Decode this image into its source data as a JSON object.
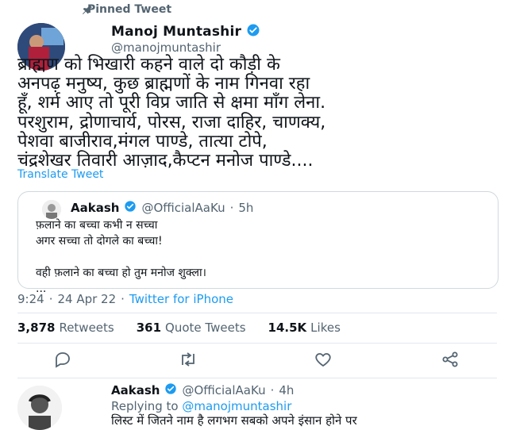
{
  "pinned": {
    "label": "Pinned Tweet",
    "icon": "pin-icon"
  },
  "tweet": {
    "author": {
      "name": "Manoj Muntashir",
      "handle": "@manojmuntashir",
      "verified_icon": "verified-badge-icon"
    },
    "text": "ब्राह्मण को भिखारी कहने वाले दो कौड़ी के\nअनपढ़ मनुष्य, कुछ ब्राह्मणों के नाम गिनवा रहा\nहूँ, शर्म आए तो पूरी विप्र जाति से क्षमा माँग लेना.\nपरशुराम, द्रोणाचार्य, पोरस, राजा दाहिर, चाणक्य,\nपेशवा बाजीराव,मंगल पाण्डे, तात्या टोपे,\nचंद्रशेखर तिवारी आज़ाद,कैप्टन मनोज पाण्डे....",
    "translate_label": "Translate Tweet"
  },
  "quoted": {
    "name": "Aakash",
    "handle": "@OfficialAaKu",
    "time": "5h",
    "text": "फ़लाने का बच्चा कभी न सच्चा\nअगर सच्चा तो दोगले का बच्चा!\n\nवही फ़लाने का बच्चा हो तुम मनोज शुक्ला।\n..."
  },
  "meta": {
    "time": "9:24",
    "date": "24 Apr 22",
    "source": "Twitter for iPhone"
  },
  "stats": {
    "retweets_count": "3,878",
    "retweets_label": "Retweets",
    "quotes_count": "361",
    "quotes_label": "Quote Tweets",
    "likes_count": "14.5K",
    "likes_label": "Likes"
  },
  "actions": {
    "reply_icon": "reply-icon",
    "retweet_icon": "retweet-icon",
    "like_icon": "heart-icon",
    "share_icon": "share-icon"
  },
  "reply": {
    "name": "Aakash",
    "handle": "@OfficialAaKu",
    "time": "4h",
    "replying_prefix": "Replying to",
    "replying_to": "@manojmuntashir",
    "text": "लिस्ट में जितने नाम है लगभग सबको अपने इंसान होने पर"
  },
  "colors": {
    "accent": "#1d9bf0",
    "secondary_text": "#536471",
    "divider": "#e1e8ed"
  }
}
